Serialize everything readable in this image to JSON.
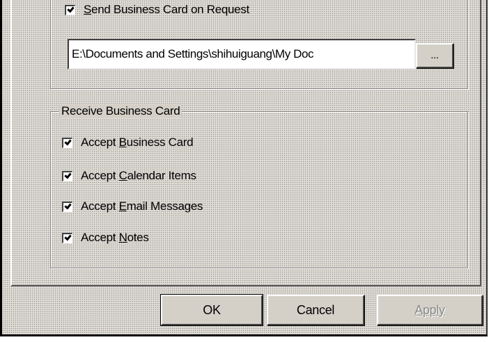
{
  "send": {
    "checkbox_label_prefix": "",
    "checkbox_label_mnemonic": "S",
    "checkbox_label_rest": "end Business Card on Request",
    "checked": true,
    "path_value": "E:\\Documents and Settings\\shihuiguang\\My Doc",
    "browse_label": "..."
  },
  "receive": {
    "group_title": "Receive Business Card",
    "items": [
      {
        "prefix": "Accept ",
        "mnemonic": "B",
        "rest": "usiness Card",
        "checked": true
      },
      {
        "prefix": "Accept ",
        "mnemonic": "C",
        "rest": "alendar Items",
        "checked": true
      },
      {
        "prefix": "Accept ",
        "mnemonic": "E",
        "rest": "mail Messages",
        "checked": true
      },
      {
        "prefix": "Accept ",
        "mnemonic": "N",
        "rest": "otes",
        "checked": true
      }
    ]
  },
  "buttons": {
    "ok_label": "OK",
    "cancel_label": "Cancel",
    "apply_label": "Apply",
    "apply_enabled": false
  },
  "colors": {
    "face": "#d4d0c8",
    "shadow": "#808080",
    "highlight": "#ffffff",
    "disabled_text": "#8a8a8a"
  }
}
